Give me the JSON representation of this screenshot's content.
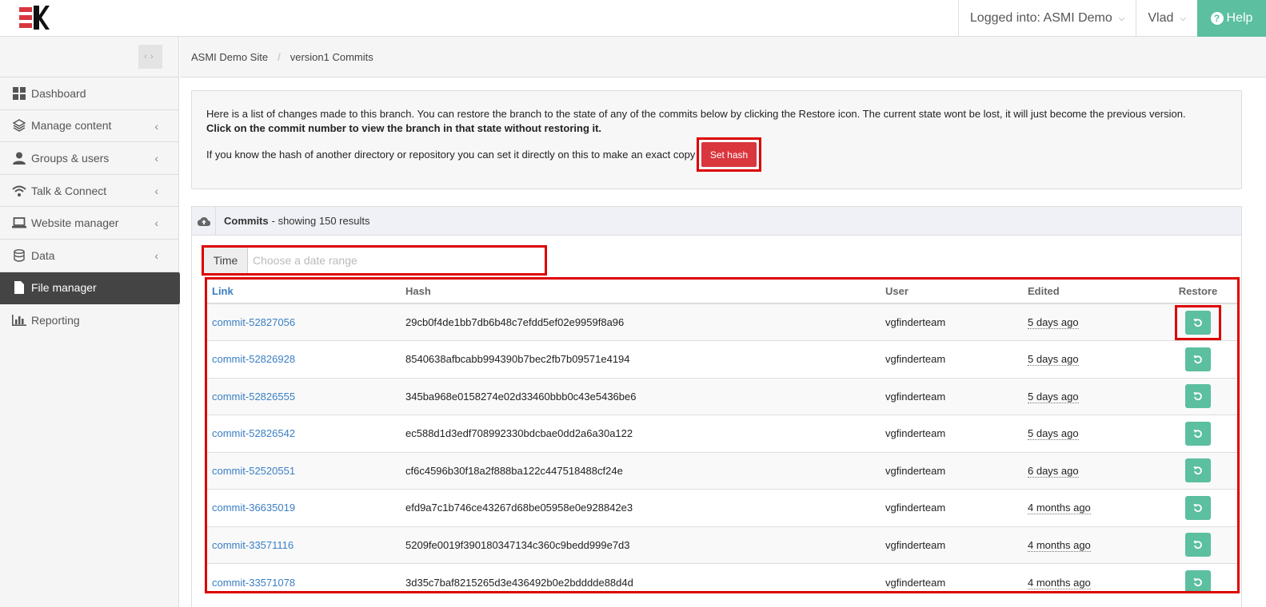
{
  "header": {
    "logged_into": "Logged into: ASMI Demo",
    "user": "Vlad",
    "help": "Help"
  },
  "sidebar": {
    "items": [
      {
        "label": "Dashboard",
        "icon": "dashboard-icon"
      },
      {
        "label": "Manage content",
        "icon": "layers-icon"
      },
      {
        "label": "Groups & users",
        "icon": "user-icon"
      },
      {
        "label": "Talk & Connect",
        "icon": "wifi-icon"
      },
      {
        "label": "Website manager",
        "icon": "laptop-icon"
      },
      {
        "label": "Data",
        "icon": "database-icon"
      },
      {
        "label": "File manager",
        "icon": "file-icon"
      },
      {
        "label": "Reporting",
        "icon": "bar-chart-icon"
      }
    ]
  },
  "breadcrumb": {
    "site": "ASMI Demo Site",
    "page": "version1 Commits"
  },
  "info": {
    "text": "Here is a list of changes made to this branch. You can restore the branch to the state of any of the commits below by clicking the Restore icon. The current state wont be lost, it will just become the previous version.",
    "bold": "Click on the commit number to view the branch in that state without restoring it.",
    "hash_text": "If you know the hash of another directory or repository you can set it directly on this to make an exact copy",
    "set_hash": "Set hash"
  },
  "commits": {
    "title": "Commits",
    "subtitle": "- showing 150 results",
    "time_label": "Time",
    "time_placeholder": "Choose a date range",
    "columns": {
      "link": "Link",
      "hash": "Hash",
      "user": "User",
      "edited": "Edited",
      "restore": "Restore"
    },
    "rows": [
      {
        "link": "commit-52827056",
        "hash": "29cb0f4de1bb7db6b48c7efdd5ef02e9959f8a96",
        "user": "vgfinderteam",
        "edited": "5 days ago"
      },
      {
        "link": "commit-52826928",
        "hash": "8540638afbcabb994390b7bec2fb7b09571e4194",
        "user": "vgfinderteam",
        "edited": "5 days ago"
      },
      {
        "link": "commit-52826555",
        "hash": "345ba968e0158274e02d33460bbb0c43e5436be6",
        "user": "vgfinderteam",
        "edited": "5 days ago"
      },
      {
        "link": "commit-52826542",
        "hash": "ec588d1d3edf708992330bdcbae0dd2a6a30a122",
        "user": "vgfinderteam",
        "edited": "5 days ago"
      },
      {
        "link": "commit-52520551",
        "hash": "cf6c4596b30f18a2f888ba122c447518488cf24e",
        "user": "vgfinderteam",
        "edited": "6 days ago"
      },
      {
        "link": "commit-36635019",
        "hash": "efd9a7c1b746ce43267d68be05958e0e928842e3",
        "user": "vgfinderteam",
        "edited": "4 months ago"
      },
      {
        "link": "commit-33571116",
        "hash": "5209fe0019f390180347134c360c9bedd999e7d3",
        "user": "vgfinderteam",
        "edited": "4 months ago"
      },
      {
        "link": "commit-33571078",
        "hash": "3d35c7baf8215265d3e436492b0e2bdddde88d4d",
        "user": "vgfinderteam",
        "edited": "4 months ago"
      }
    ]
  },
  "colors": {
    "accent": "#5bbfa0",
    "danger": "#d9363e",
    "link": "#3a7fc4",
    "sidebar_active": "#444444"
  }
}
